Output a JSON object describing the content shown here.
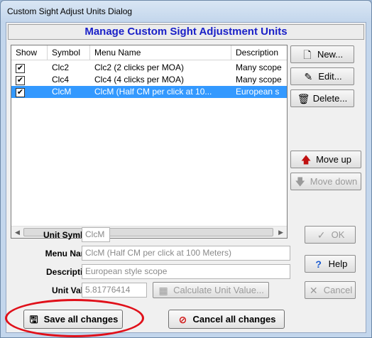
{
  "window": {
    "title": "Custom Sight Adjust Units Dialog"
  },
  "header": {
    "title": "Manage Custom Sight Adjustment Units"
  },
  "list": {
    "columns": [
      "Show",
      "Symbol",
      "Menu Name",
      "Description"
    ],
    "rows": [
      {
        "show": "✔",
        "symbol": "Clc2",
        "menu": "Clc2 (2 clicks per MOA)",
        "desc": "Many scope"
      },
      {
        "show": "✔",
        "symbol": "Clc4",
        "menu": "Clc4 (4 clicks per MOA)",
        "desc": "Many scope"
      },
      {
        "show": "✔",
        "symbol": "ClcM",
        "menu": "ClcM (Half CM per click at 10...",
        "desc": "European s"
      }
    ]
  },
  "side_buttons": {
    "new": "New...",
    "edit": "Edit...",
    "delete": "Delete...",
    "move_up": "Move up",
    "move_down": "Move down"
  },
  "form": {
    "unit_symbol_label": "Unit Symbol:",
    "unit_symbol": "ClcM",
    "menu_name_label": "Menu Name:",
    "menu_name": "ClcM (Half CM per click at 100 Meters)",
    "description_label": "Description:",
    "description": "European style scope",
    "unit_value_label": "Unit Value:",
    "unit_value": "5.81776414",
    "calculate": "Calculate Unit Value..."
  },
  "dialog_buttons": {
    "ok": "OK",
    "help": "Help",
    "cancel": "Cancel"
  },
  "bottom": {
    "save": "Save all changes",
    "cancel_all": "Cancel all changes"
  },
  "colors": {
    "header_text": "#1a20c8",
    "selection": "#3399ff",
    "annotation": "#e0101a"
  }
}
